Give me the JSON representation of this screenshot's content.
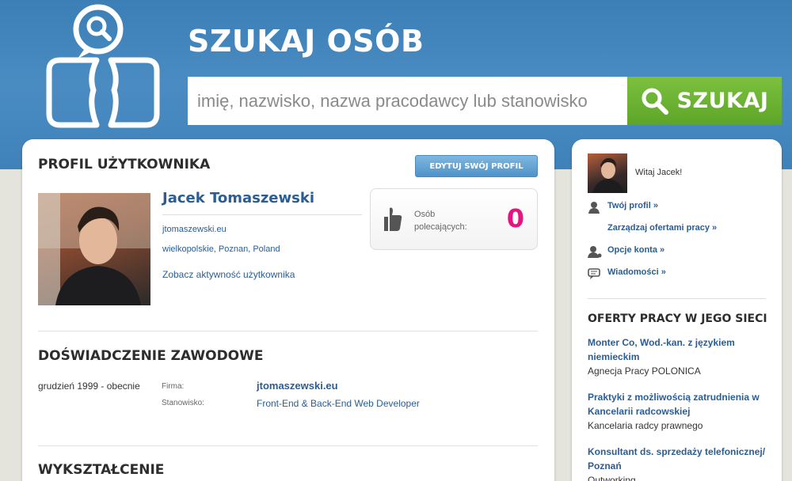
{
  "header": {
    "title": "SZUKAJ OSÓB",
    "search_placeholder": "imię, nazwisko, nazwa pracodawcy lub stanowisko",
    "search_button": "SZUKAJ"
  },
  "profile": {
    "section_title": "PROFIL UŻYTKOWNIKA",
    "edit_button": "EDYTUJ SWÓJ PROFIL",
    "name": "Jacek Tomaszewski",
    "website": "jtomaszewski.eu",
    "location": "wielkopolskie, Poznan, Poland",
    "activity_link": "Zobacz aktywność użytkownika",
    "recommend_label": "Osób polecających:",
    "recommend_count": "0"
  },
  "experience": {
    "section_title": "DOŚWIADCZENIE ZAWODOWE",
    "date": "grudzień 1999 - obecnie",
    "company_key": "Firma:",
    "company_value": "jtomaszewski.eu",
    "position_key": "Stanowisko:",
    "position_value": "Front-End & Back-End Web Developer"
  },
  "education": {
    "section_title": "WYKSZTAŁCENIE"
  },
  "sidebar": {
    "greeting": "Witaj Jacek!",
    "links": [
      {
        "label": "Twój profil »",
        "icon": "user-icon"
      },
      {
        "label": "Zarządzaj ofertami pracy »",
        "icon": ""
      },
      {
        "label": "Opcje konta »",
        "icon": "user-settings-icon"
      },
      {
        "label": "Wiadomości »",
        "icon": "messages-icon"
      }
    ],
    "jobs_title": "OFERTY PRACY W JEGO SIECI",
    "jobs": [
      {
        "title": "Monter Co, Wod.-kan. z językiem niemieckim",
        "company": "Agnecja Pracy POLONICA"
      },
      {
        "title": "Praktyki z możliwością zatrudnienia w Kancelarii radcowskiej",
        "company": "Kancelaria radcy prawnego"
      },
      {
        "title": "Konsultant ds. sprzedaży telefonicznej/ Poznań",
        "company": "Outworking"
      }
    ]
  },
  "colors": {
    "header_blue": "#3f82ba",
    "link_blue": "#2a5d94",
    "search_green": "#6cb534",
    "count_pink": "#e5157f"
  }
}
